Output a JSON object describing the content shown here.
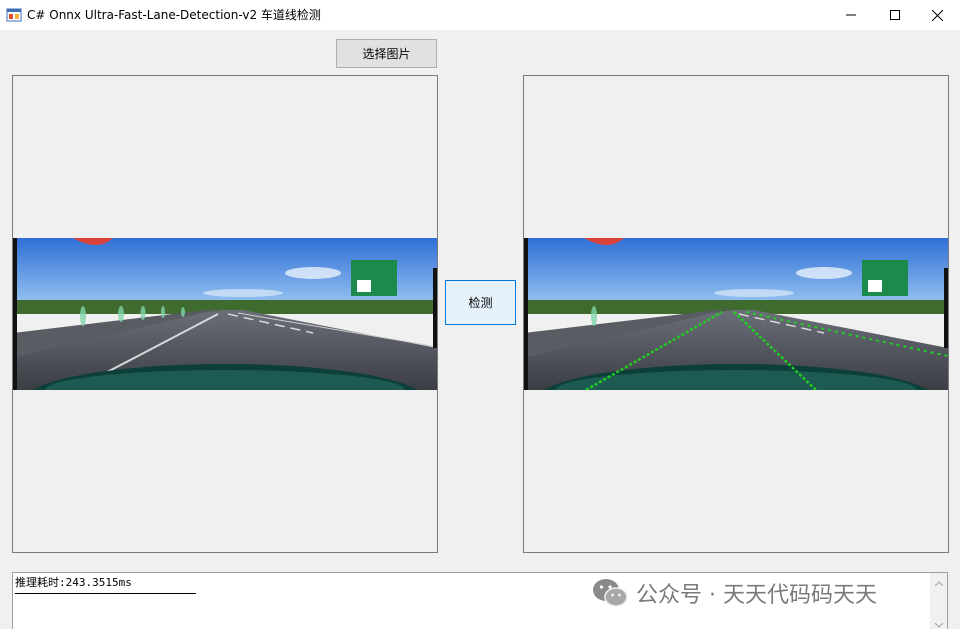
{
  "window": {
    "title": "C# Onnx Ultra-Fast-Lane-Detection-v2 车道线检测",
    "icon": "winforms-app-icon",
    "controls": [
      "minimize-icon",
      "maximize-icon",
      "close-icon"
    ]
  },
  "toolbar": {
    "select_image_label": "选择图片",
    "detect_label": "检测"
  },
  "images": {
    "left": {
      "description_icon": "road-photo"
    },
    "right": {
      "description_icon": "road-photo-with-lanes",
      "lane_color": "#22cc22"
    }
  },
  "output": {
    "text": "推理耗时:243.3515ms"
  },
  "watermark": {
    "text": "公众号 · 天天代码码天天",
    "icon": "wechat-icon"
  },
  "colors": {
    "window_bg": "#f0f0f0",
    "accent": "#0078d7",
    "lane": "#22cc22"
  }
}
